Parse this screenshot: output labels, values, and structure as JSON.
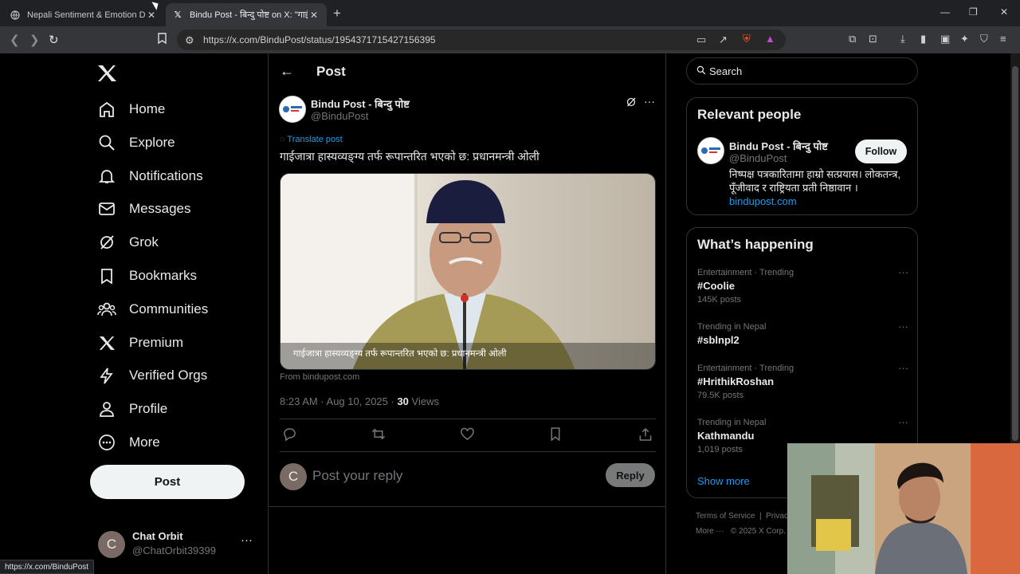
{
  "browser": {
    "tabs": [
      {
        "title": "Nepali Sentiment & Emotion Dataset",
        "favicon": "globe-icon",
        "active": false
      },
      {
        "title": "Bindu Post - बिन्दु पोष्ट on X: \"गाईजात्रा\"",
        "favicon": "x-logo-icon",
        "active": true
      }
    ],
    "url": "https://x.com/BinduPost/status/1954371715427156395",
    "status_url": "https://x.com/BinduPost"
  },
  "nav": {
    "items": [
      {
        "label": "Home",
        "icon": "home-icon"
      },
      {
        "label": "Explore",
        "icon": "search-icon"
      },
      {
        "label": "Notifications",
        "icon": "bell-icon"
      },
      {
        "label": "Messages",
        "icon": "mail-icon"
      },
      {
        "label": "Grok",
        "icon": "grok-icon"
      },
      {
        "label": "Bookmarks",
        "icon": "bookmark-icon"
      },
      {
        "label": "Communities",
        "icon": "communities-icon"
      },
      {
        "label": "Premium",
        "icon": "x-logo-icon"
      },
      {
        "label": "Verified Orgs",
        "icon": "lightning-icon"
      },
      {
        "label": "Profile",
        "icon": "person-icon"
      },
      {
        "label": "More",
        "icon": "more-circle-icon"
      }
    ],
    "post_button": "Post",
    "account": {
      "name": "Chat Orbit",
      "handle": "@ChatOrbit39399",
      "initial": "C"
    }
  },
  "main": {
    "header_title": "Post",
    "post": {
      "author_name": "Bindu Post - बिन्दु पोष्ट",
      "author_handle": "@BinduPost",
      "translate_label": "Translate post",
      "text": "गाईजात्रा हास्यव्यङ्ग्य तर्फ रूपान्तरित भएको छ: प्रधानमन्त्री ओली",
      "media_caption": "गाईजात्रा हास्यव्यङ्ग्य तर्फ रूपान्तरित भएको छ: प्रधानमन्त्री ओली",
      "from_label": "From bindupost.com",
      "time": "8:23 AM · Aug 10, 2025 · ",
      "views_count": "30",
      "views_label": " Views"
    },
    "reply": {
      "placeholder": "Post your reply",
      "button": "Reply",
      "avatar_initial": "C"
    }
  },
  "sidebar": {
    "search_placeholder": "Search",
    "relevant_people": {
      "title": "Relevant people",
      "name": "Bindu Post - बिन्दु पोष्ट",
      "handle": "@BinduPost",
      "follow_label": "Follow",
      "bio": "निष्पक्ष पत्रकारितामा हाम्रो सत्प्रयास। लोकतन्त्र, पूँजीवाद र राष्ट्रियता प्रती निष्ठावान ।",
      "link": "bindupost.com"
    },
    "whats_happening": {
      "title": "What’s happening",
      "trends": [
        {
          "context": "Entertainment · Trending",
          "name": "#Coolie",
          "posts": "145K posts"
        },
        {
          "context": "Trending in Nepal",
          "name": "#sblnpl2",
          "posts": ""
        },
        {
          "context": "Entertainment · Trending",
          "name": "#HrithikRoshan",
          "posts": "79.5K posts"
        },
        {
          "context": "Trending in Nepal",
          "name": "Kathmandu",
          "posts": "1,019 posts"
        }
      ],
      "show_more": "Show more"
    },
    "footer": {
      "line1": "Terms of Service  |  Privac",
      "line2": "More ···   © 2025 X Corp."
    }
  },
  "colors": {
    "accent": "#1d9bf0",
    "background": "#000000",
    "border": "#2f3336",
    "muted": "#71767b"
  }
}
